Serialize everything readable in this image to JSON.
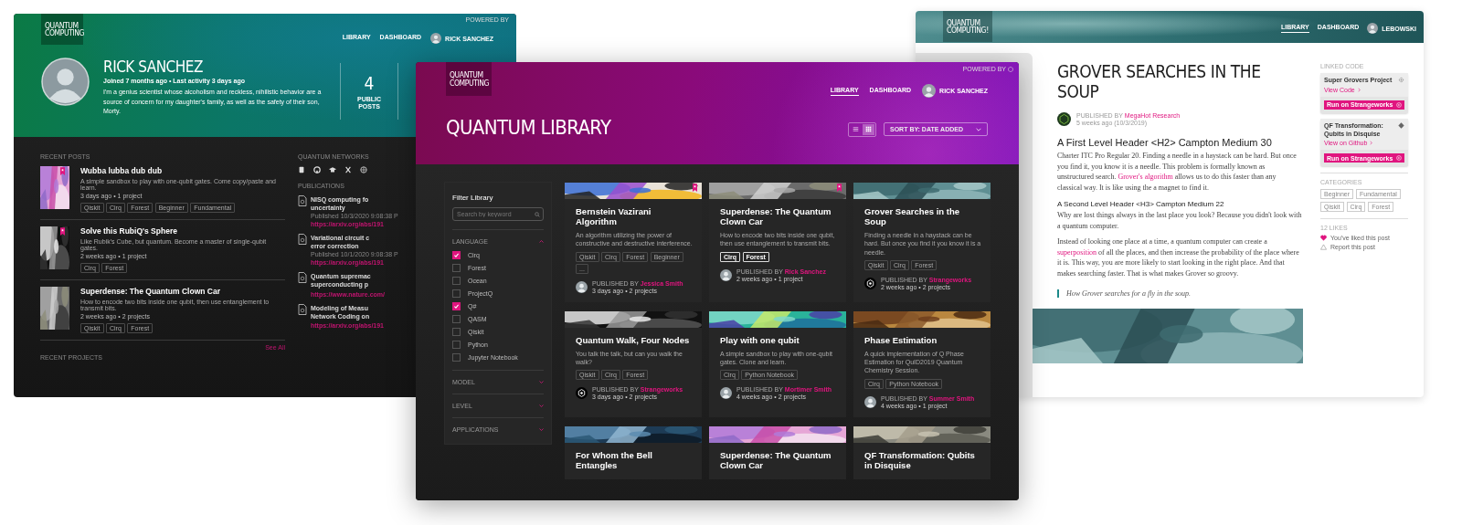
{
  "profile_window": {
    "logo": [
      "QUANTUM",
      "COMPUTING"
    ],
    "powered_by": "POWERED BY",
    "nav": [
      {
        "label": "LIBRARY",
        "selected": false
      },
      {
        "label": "DASHBOARD",
        "selected": false
      }
    ],
    "user": "RICK SANCHEZ",
    "name": "RICK SANCHEZ",
    "activity": "Joined 7 months ago • Last activity 3 days ago",
    "bio": "I'm a genius scientist whose alcoholism and reckless, nihilistic behavior are a source of concern for my daughter's family, as well as the safety of their son, Morty.",
    "stat": {
      "value": "4",
      "label": "PUBLIC POSTS"
    },
    "recent_posts_heading": "RECENT POSTS",
    "posts": [
      {
        "title": "Wubba lubba dub dub",
        "description": "A simple sandbox to play with one-qubit gates. Come copy/paste and learn.",
        "meta": "3 days ago • 1 project",
        "tags": [
          "Qiskit",
          "Cirq",
          "Forest",
          "Beginner",
          "Fundamental"
        ],
        "bookmarked": true
      },
      {
        "title": "Solve this RubiQ's Sphere",
        "description": "Like Rubik's Cube, but quantum. Become a master of single-qubit gates.",
        "meta": "2 weeks ago • 1 project",
        "tags": [
          "Cirq",
          "Forest"
        ],
        "bookmarked": true
      },
      {
        "title": "Superdense: The Quantum Clown Car",
        "description": "How to encode two bits inside one qubit, then use entanglement to transmit bits.",
        "meta": "2 weeks ago • 2 projects",
        "tags": [
          "Qiskit",
          "Cirq",
          "Forest"
        ],
        "bookmarked": false
      }
    ],
    "see_all": "See All",
    "recent_projects_heading": "RECENT PROJECTS",
    "networks_heading": "QUANTUM NETWORKS",
    "publications_heading": "PUBLICATIONS",
    "publications": [
      {
        "title_lines": [
          "NISQ computing fo",
          "uncertainty"
        ],
        "published": "Published 10/3/2020 9:08:38 P",
        "link": "https://arxiv.org/abs/191"
      },
      {
        "title_lines": [
          "Variational circuit c",
          "error correction"
        ],
        "published": "Published 10/1/2020 9:08:38 P",
        "link": "https://arxiv.org/abs/191"
      },
      {
        "title_lines": [
          "Quantum supremac",
          "superconducting p"
        ],
        "link": "https://www.nature.com/"
      },
      {
        "title_lines": [
          "Modeling of Measu",
          "Network Coding on"
        ],
        "link": "https://arxiv.org/abs/191"
      }
    ]
  },
  "article_window": {
    "logo": [
      "QUANTUM",
      "COMPUTING!"
    ],
    "nav": [
      {
        "label": "LIBRARY",
        "selected": true
      },
      {
        "label": "DASHBOARD",
        "selected": false
      }
    ],
    "user": "LEBOWSKI",
    "title": "GROVER SEARCHES IN THE SOUP",
    "published_by": "PUBLISHED BY",
    "publisher": "MegaHot Research",
    "date": "5 weeks ago (10/3/2019)",
    "blocks": [
      {
        "kind": "h2",
        "text": "A First Level Header <H2> Campton Medium 30"
      },
      {
        "kind": "p",
        "parts": [
          {
            "kind": "text",
            "text": "Charter ITC Pro Regular 20. Finding a needle in a haystack can be hard. But once you find it, you know it is a needle. This problem is formally known as unstructured search. "
          },
          {
            "kind": "link",
            "text": "Grover's algorithm"
          },
          {
            "kind": "text",
            "text": " allows us to do this faster than any classical way. It is like using the a magnet to find it."
          }
        ]
      },
      {
        "kind": "h3",
        "text": "A Second Level Header <H3> Campton Medium 22"
      },
      {
        "kind": "p",
        "parts": [
          {
            "kind": "text",
            "text": "Why are lost things always in the last place you look? Because you didn't look with a quantum computer."
          }
        ]
      },
      {
        "kind": "p",
        "parts": [
          {
            "kind": "text",
            "text": "Instead of looking one place at a time, a quantum computer can create a "
          },
          {
            "kind": "link",
            "text": "superposition"
          },
          {
            "kind": "text",
            "text": " of all the places, and then increase the probability of the place where it is. This way, you are more likely to start looking in the right place. And that makes searching faster. That is what makes Grover so groovy."
          }
        ]
      },
      {
        "kind": "quote",
        "text": "How Grover searches for a fly in the soup."
      },
      {
        "kind": "picture"
      }
    ],
    "linked_code_heading": "LINKED CODE",
    "code_cards": [
      {
        "title": "Super Grovers Project",
        "link": "View Code",
        "kind": "gear",
        "button": "Run on Strangeworks"
      },
      {
        "title": "QF Transformation: Qubits in Disquise",
        "link": "View on Github",
        "kind": "diamond",
        "button": "Run on Strangeworks"
      }
    ],
    "categories_heading": "CATEGORIES",
    "categories": [
      "Beginner",
      "Fundamental",
      "Qiskit",
      "Cirq",
      "Forest"
    ],
    "likes": "12 LIKES",
    "liked": true,
    "liked_text": "You've liked this post",
    "report": "Report this post"
  },
  "library_window": {
    "logo": [
      "QUANTUM",
      "COMPUTING"
    ],
    "powered_by": "POWERED BY",
    "nav": [
      {
        "label": "LIBRARY",
        "selected": true
      },
      {
        "label": "DASHBOARD",
        "selected": false
      }
    ],
    "user": "RICK SANCHEZ",
    "title": "QUANTUM LIBRARY",
    "views": [
      {
        "kind": "list",
        "selected": false
      },
      {
        "kind": "grid",
        "selected": true
      }
    ],
    "sort": "SORT BY: DATE ADDED",
    "filter": {
      "title": "Filter Library",
      "placeholder": "Search by keyword",
      "sections": [
        {
          "label": "LANGUAGE",
          "expanded": true,
          "options": [
            {
              "label": "Cirq",
              "checked": true
            },
            {
              "label": "Forest",
              "checked": false
            },
            {
              "label": "Ocean",
              "checked": false
            },
            {
              "label": "ProjectQ",
              "checked": false
            },
            {
              "label": "Q#",
              "checked": true
            },
            {
              "label": "QASM",
              "checked": false
            },
            {
              "label": "Qiskit",
              "checked": false
            },
            {
              "label": "Python",
              "checked": false
            },
            {
              "label": "Jupyter Notebook",
              "checked": false
            }
          ]
        },
        {
          "label": "MODEL",
          "expanded": false
        },
        {
          "label": "LEVEL",
          "expanded": false
        },
        {
          "label": "APPLICATIONS",
          "expanded": false
        }
      ]
    },
    "cards": [
      {
        "title": "Bernstein Vazirani Algorithm",
        "description": "An algorithm utilizing the power of constructive and destructive interference.",
        "tags": [
          {
            "label": "Qiskit",
            "active": false
          },
          {
            "label": "Cirq",
            "active": false
          },
          {
            "label": "Forest",
            "active": false
          },
          {
            "label": "Beginner",
            "active": false
          },
          {
            "label": "...",
            "active": false
          }
        ],
        "publisher": {
          "label": "PUBLISHED BY",
          "name": "Jessica Smith",
          "kind": "person"
        },
        "meta": "3 days ago • 2 projects",
        "bookmarked": true
      },
      {
        "title": "Superdense: The Quantum Clown Car",
        "description": "How to encode two bits inside one qubit, then use entanglement to transmit bits.",
        "tags": [
          {
            "label": "Cirq",
            "active": true
          },
          {
            "label": "Forest",
            "active": true
          }
        ],
        "publisher": {
          "label": "PUBLISHED BY",
          "name": "Rick Sanchez",
          "kind": "person"
        },
        "meta": "2 weeks ago • 1 project",
        "bookmarked": true
      },
      {
        "title": "Grover Searches in the Soup",
        "description": "Finding a needle in a haystack can be hard. But once you find it you know it is a needle.",
        "tags": [
          {
            "label": "Qiskit",
            "active": false
          },
          {
            "label": "Cirq",
            "active": false
          },
          {
            "label": "Forest",
            "active": false
          }
        ],
        "publisher": {
          "label": "PUBLISHED BY",
          "name": "Strangeworks",
          "kind": "logo"
        },
        "meta": "2 weeks ago • 2 projects",
        "bookmarked": false
      },
      {
        "title": "Quantum Walk, Four Nodes",
        "description": "You talk the talk, but can you walk the walk?",
        "tags": [
          {
            "label": "Qiskit",
            "active": false
          },
          {
            "label": "Cirq",
            "active": false
          },
          {
            "label": "Forest",
            "active": false
          }
        ],
        "publisher": {
          "label": "PUBLISHED BY",
          "name": "Strangeworks",
          "kind": "logo"
        },
        "meta": "3 days ago • 2 projects",
        "bookmarked": false
      },
      {
        "title": "Play with one qubit",
        "description": "A simple sandbox to play with one-qubit gates. Clone and learn.",
        "tags": [
          {
            "label": "Cirq",
            "active": false
          },
          {
            "label": "Python Notebook",
            "active": false
          }
        ],
        "publisher": {
          "label": "PUBLISHED BY",
          "name": "Mortimer Smith",
          "kind": "person"
        },
        "meta": "4 weeks ago • 2 projects",
        "bookmarked": false
      },
      {
        "title": "Phase Estimation",
        "description": "A quick implementation of Q Phase Estimation for QuID2019 Quantum Chemistry Session.",
        "tags": [
          {
            "label": "Cirq",
            "active": false
          },
          {
            "label": "Python Notebook",
            "active": false
          }
        ],
        "publisher": {
          "label": "PUBLISHED BY",
          "name": "Summer Smith",
          "kind": "person"
        },
        "meta": "4 weeks ago • 1 project",
        "bookmarked": false
      },
      {
        "title": "For Whom the Bell Entangles",
        "bookmarked": false
      },
      {
        "title": "Superdense: The Quantum Clown Car",
        "bookmarked": false
      },
      {
        "title": "QF Transformation: Qubits in Disquise",
        "bookmarked": false
      }
    ]
  }
}
